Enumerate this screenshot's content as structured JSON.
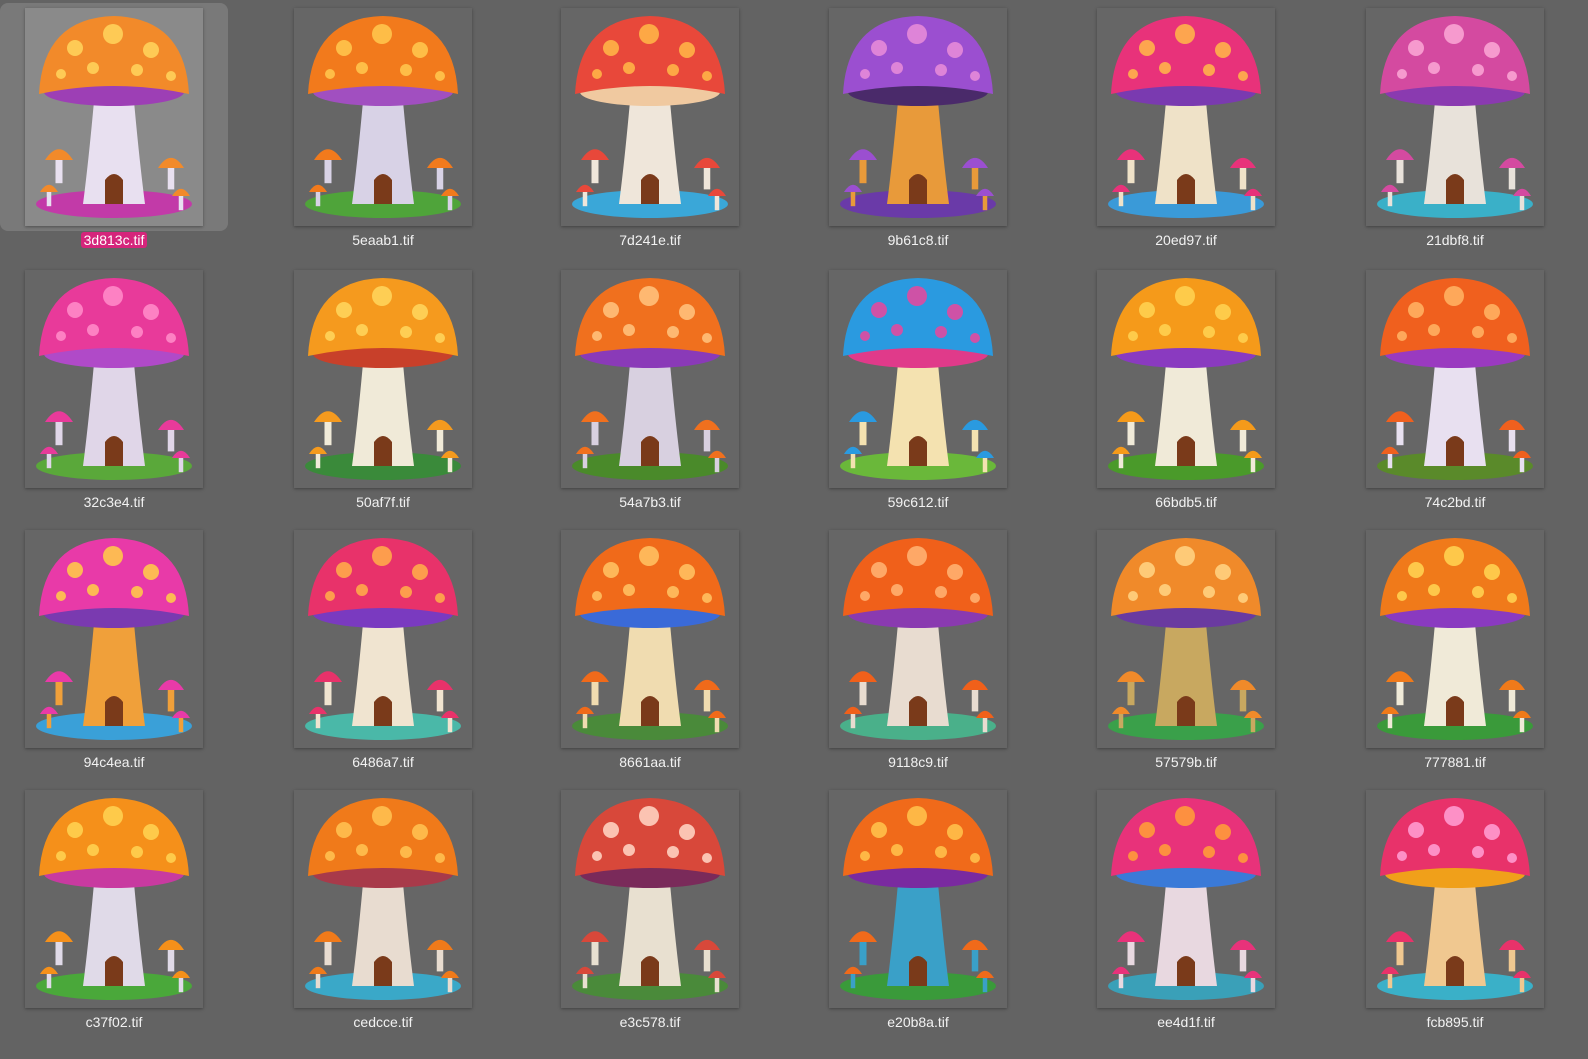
{
  "window": {
    "background": "#636363",
    "selection_label_color": "#d5257b"
  },
  "files": [
    {
      "name": "3d813c.tif",
      "selected": true,
      "cap": "#f28a2a",
      "spot": "#ffd05a",
      "gill": "#9d3fb5",
      "stem": "#e8e0f0",
      "bg": "#8a8a8a",
      "ground": "#c23aa8"
    },
    {
      "name": "5eaab1.tif",
      "selected": false,
      "cap": "#f27a1c",
      "spot": "#ffc44d",
      "gill": "#a14fc0",
      "stem": "#d8d2e6",
      "bg": "#666666",
      "ground": "#4fa43a"
    },
    {
      "name": "7d241e.tif",
      "selected": false,
      "cap": "#e8483a",
      "spot": "#ffb347",
      "gill": "#f0c9a0",
      "stem": "#efe6da",
      "bg": "#666666",
      "ground": "#3aa7d8"
    },
    {
      "name": "9b61c8.tif",
      "selected": false,
      "cap": "#9b4fd0",
      "spot": "#e68ad8",
      "gill": "#4a2a6a",
      "stem": "#e89a3a",
      "bg": "#666666",
      "ground": "#6a3aa8"
    },
    {
      "name": "20ed97.tif",
      "selected": false,
      "cap": "#e8327a",
      "spot": "#ffb14a",
      "gill": "#7a3ab0",
      "stem": "#efe2c8",
      "bg": "#666666",
      "ground": "#3a9ad8"
    },
    {
      "name": "21dbf8.tif",
      "selected": false,
      "cap": "#d44aa0",
      "spot": "#f9a3d3",
      "gill": "#8a3ab0",
      "stem": "#e8e2da",
      "bg": "#666666",
      "ground": "#3ab0c8"
    },
    {
      "name": "32c3e4.tif",
      "selected": false,
      "cap": "#e83a9a",
      "spot": "#ff8ac8",
      "gill": "#b04ac8",
      "stem": "#e0d6e8",
      "bg": "#666666",
      "ground": "#5aa83a"
    },
    {
      "name": "50af7f.tif",
      "selected": false,
      "cap": "#f59a1e",
      "spot": "#ffd45a",
      "gill": "#c8402a",
      "stem": "#f0ead8",
      "bg": "#666666",
      "ground": "#3a8a3a"
    },
    {
      "name": "54a7b3.tif",
      "selected": false,
      "cap": "#f0701e",
      "spot": "#ffc07a",
      "gill": "#8a3ab8",
      "stem": "#d8d0e0",
      "bg": "#666666",
      "ground": "#4a8a2a"
    },
    {
      "name": "59c612.tif",
      "selected": false,
      "cap": "#2a9ae0",
      "spot": "#e04aa0",
      "gill": "#e03a8a",
      "stem": "#f4e2b0",
      "bg": "#666666",
      "ground": "#6ab83a"
    },
    {
      "name": "66bdb5.tif",
      "selected": false,
      "cap": "#f59a1a",
      "spot": "#ffd050",
      "gill": "#8a3ac0",
      "stem": "#f0ead8",
      "bg": "#666666",
      "ground": "#4a9a2a"
    },
    {
      "name": "74c2bd.tif",
      "selected": false,
      "cap": "#f0601e",
      "spot": "#ffb060",
      "gill": "#9a3ac0",
      "stem": "#e8e0f0",
      "bg": "#666666",
      "ground": "#5a8a2a"
    },
    {
      "name": "94c4ea.tif",
      "selected": false,
      "cap": "#e83aa8",
      "spot": "#ffc84a",
      "gill": "#7a3ab0",
      "stem": "#f0a03a",
      "bg": "#666666",
      "ground": "#3aa0d8"
    },
    {
      "name": "6486a7.tif",
      "selected": false,
      "cap": "#e8326a",
      "spot": "#ffa84a",
      "gill": "#7a3ac0",
      "stem": "#f0e4d0",
      "bg": "#666666",
      "ground": "#4ab8a8"
    },
    {
      "name": "8661aa.tif",
      "selected": false,
      "cap": "#f06a1a",
      "spot": "#ffc060",
      "gill": "#3a6ad8",
      "stem": "#f0dcb0",
      "bg": "#666666",
      "ground": "#4a8a3a"
    },
    {
      "name": "9118c9.tif",
      "selected": false,
      "cap": "#f0601a",
      "spot": "#ffb070",
      "gill": "#8a3ab0",
      "stem": "#e8dcd0",
      "bg": "#666666",
      "ground": "#4ab08a"
    },
    {
      "name": "57579b.tif",
      "selected": false,
      "cap": "#f08a2a",
      "spot": "#ffd080",
      "gill": "#6a3aa0",
      "stem": "#c8a860",
      "bg": "#666666",
      "ground": "#3aa04a"
    },
    {
      "name": "777881.tif",
      "selected": false,
      "cap": "#f07a1a",
      "spot": "#ffd050",
      "gill": "#8a3ac0",
      "stem": "#f0ead8",
      "bg": "#666666",
      "ground": "#3a9a3a"
    },
    {
      "name": "c37f02.tif",
      "selected": false,
      "cap": "#f5901a",
      "spot": "#ffd050",
      "gill": "#c83aa0",
      "stem": "#e0dae8",
      "bg": "#666666",
      "ground": "#4aa83a"
    },
    {
      "name": "cedcce.tif",
      "selected": false,
      "cap": "#f07a1a",
      "spot": "#ffc050",
      "gill": "#a83a4a",
      "stem": "#e8dcd0",
      "bg": "#666666",
      "ground": "#3aa8c8"
    },
    {
      "name": "e3c578.tif",
      "selected": false,
      "cap": "#d8483a",
      "spot": "#ffd0c0",
      "gill": "#7a2a5a",
      "stem": "#e8e0d0",
      "bg": "#666666",
      "ground": "#4a8a3a"
    },
    {
      "name": "e20b8a.tif",
      "selected": false,
      "cap": "#f06a1a",
      "spot": "#ffc04a",
      "gill": "#7a2aa0",
      "stem": "#3aa0c8",
      "bg": "#666666",
      "ground": "#3a9a3a"
    },
    {
      "name": "ee4d1f.tif",
      "selected": false,
      "cap": "#e8327a",
      "spot": "#ff9a3a",
      "gill": "#3a7ad8",
      "stem": "#e8d8e0",
      "bg": "#666666",
      "ground": "#3aa0b8"
    },
    {
      "name": "fcb895.tif",
      "selected": false,
      "cap": "#e8326a",
      "spot": "#ff9ad0",
      "gill": "#f0a01a",
      "stem": "#f0c890",
      "bg": "#666666",
      "ground": "#3ab0c8"
    }
  ]
}
